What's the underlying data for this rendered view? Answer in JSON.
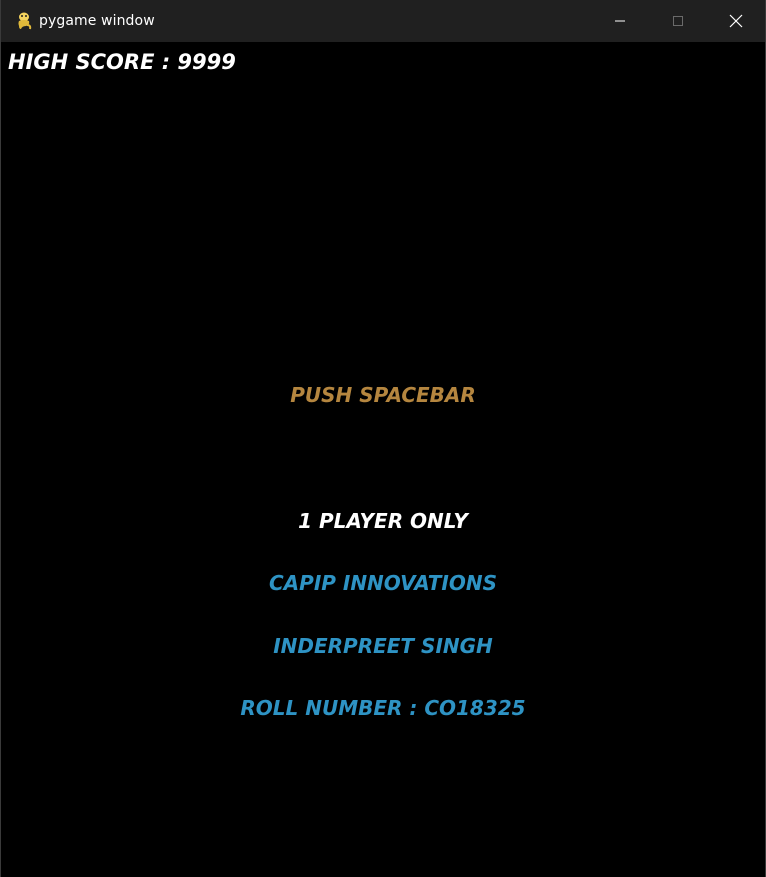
{
  "window": {
    "title": "pygame window",
    "controls": {
      "minimize_icon": "minimize-icon",
      "maximize_icon": "maximize-icon",
      "close_icon": "close-icon"
    }
  },
  "hud": {
    "high_score": "HIGH SCORE : 9999"
  },
  "menu": {
    "prompt": "PUSH SPACEBAR",
    "player_mode": "1 PLAYER ONLY",
    "company": "CAPIP INNOVATIONS",
    "author": "INDERPREET SINGH",
    "roll_number": "ROLL NUMBER : CO18325"
  },
  "colors": {
    "background": "#000000",
    "titlebar": "#202020",
    "white_text": "#ffffff",
    "prompt_text": "#b5863f",
    "credit_text": "#2e93c4"
  }
}
